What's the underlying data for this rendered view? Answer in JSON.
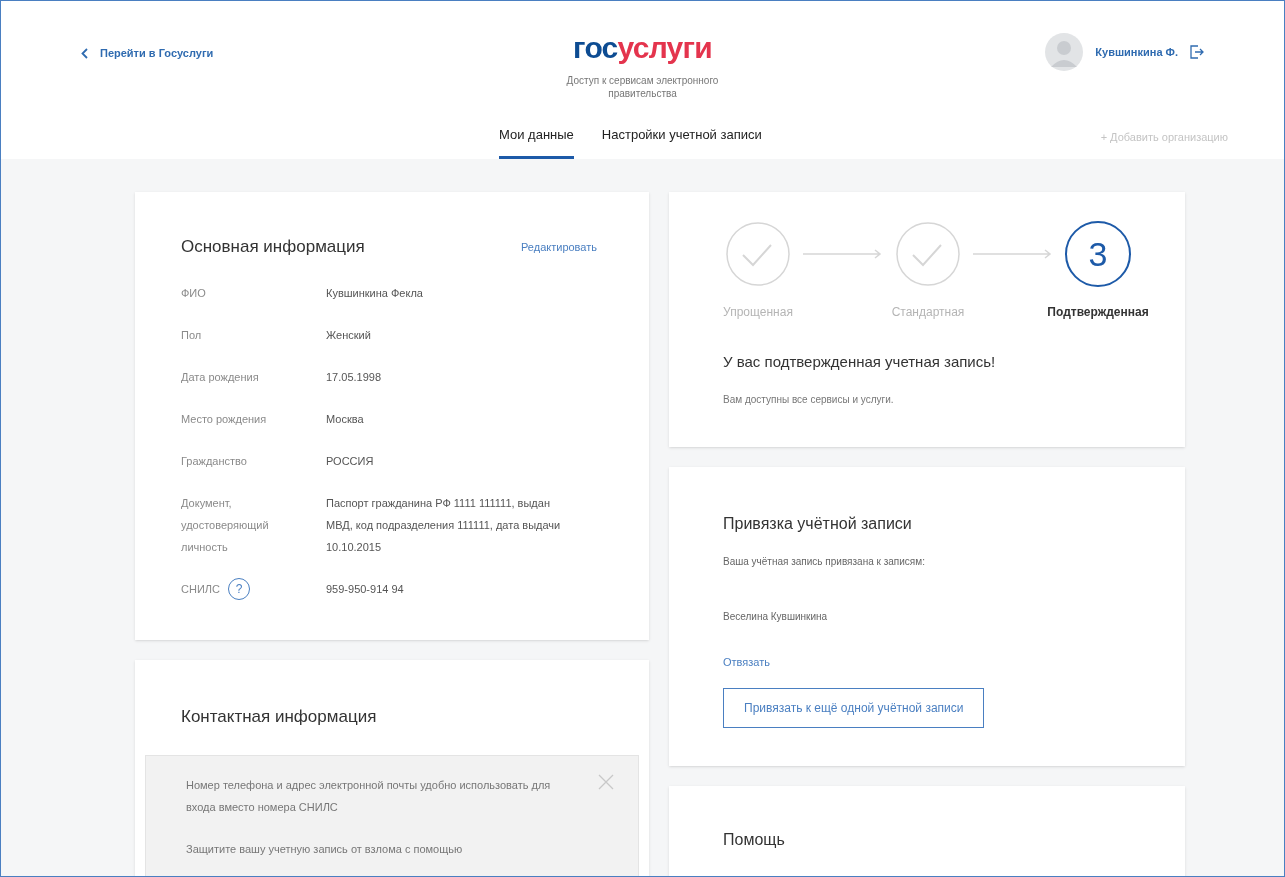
{
  "header": {
    "back_link": "Перейти в Госуслуги",
    "logo": {
      "part_1": "гос",
      "part_2": "услуги"
    },
    "subtitle": "Доступ к сервисам электронного правительства",
    "user_name": "Кувшинкина Ф.",
    "add_org": "+ Добавить организацию"
  },
  "tabs": [
    {
      "label": "Мои данные",
      "selected": true
    },
    {
      "label": "Настройки учетной записи",
      "selected": false
    }
  ],
  "basic_info": {
    "title": "Основная информация",
    "edit_link": "Редактировать",
    "rows": [
      {
        "label": "ФИО",
        "value": "Кувшинкина Фекла"
      },
      {
        "label": "Пол",
        "value": "Женский"
      },
      {
        "label": "Дата рождения",
        "value": "17.05.1998"
      },
      {
        "label": "Место рождения",
        "value": "Москва"
      },
      {
        "label": "Гражданство",
        "value": "РОССИЯ"
      },
      {
        "label": "Документ, удостоверяющий личность",
        "value": "Паспорт гражданина РФ 1111 111111, выдан МВД, код подразделения 111111, дата выдачи 10.10.2015"
      },
      {
        "label": "СНИЛС",
        "value": "959-950-914 94",
        "help": "?"
      }
    ]
  },
  "contact_info": {
    "title": "Контактная информация",
    "notice": [
      "Номер телефона и адрес электронной почты удобно использовать для входа вместо номера СНИЛС",
      "Защитите вашу учетную запись от взлома с помощью"
    ]
  },
  "account_level": {
    "steps": [
      {
        "label": "Упрощенная",
        "kind": "done"
      },
      {
        "label": "Стандартная",
        "kind": "done"
      },
      {
        "label": "Подтвержденная",
        "kind": "current",
        "number": "3"
      }
    ],
    "title": "У вас подтвержденная учетная запись!",
    "text": "Вам доступны все сервисы и услуги."
  },
  "binding": {
    "title": "Привязка учётной записи",
    "text": "Ваша учётная запись привязана к записям:",
    "linked_name": "Веселина Кувшинкина",
    "unlink": "Отвязать",
    "button": "Привязать к ещё одной учётной записи"
  },
  "help": {
    "title": "Помощь"
  }
}
